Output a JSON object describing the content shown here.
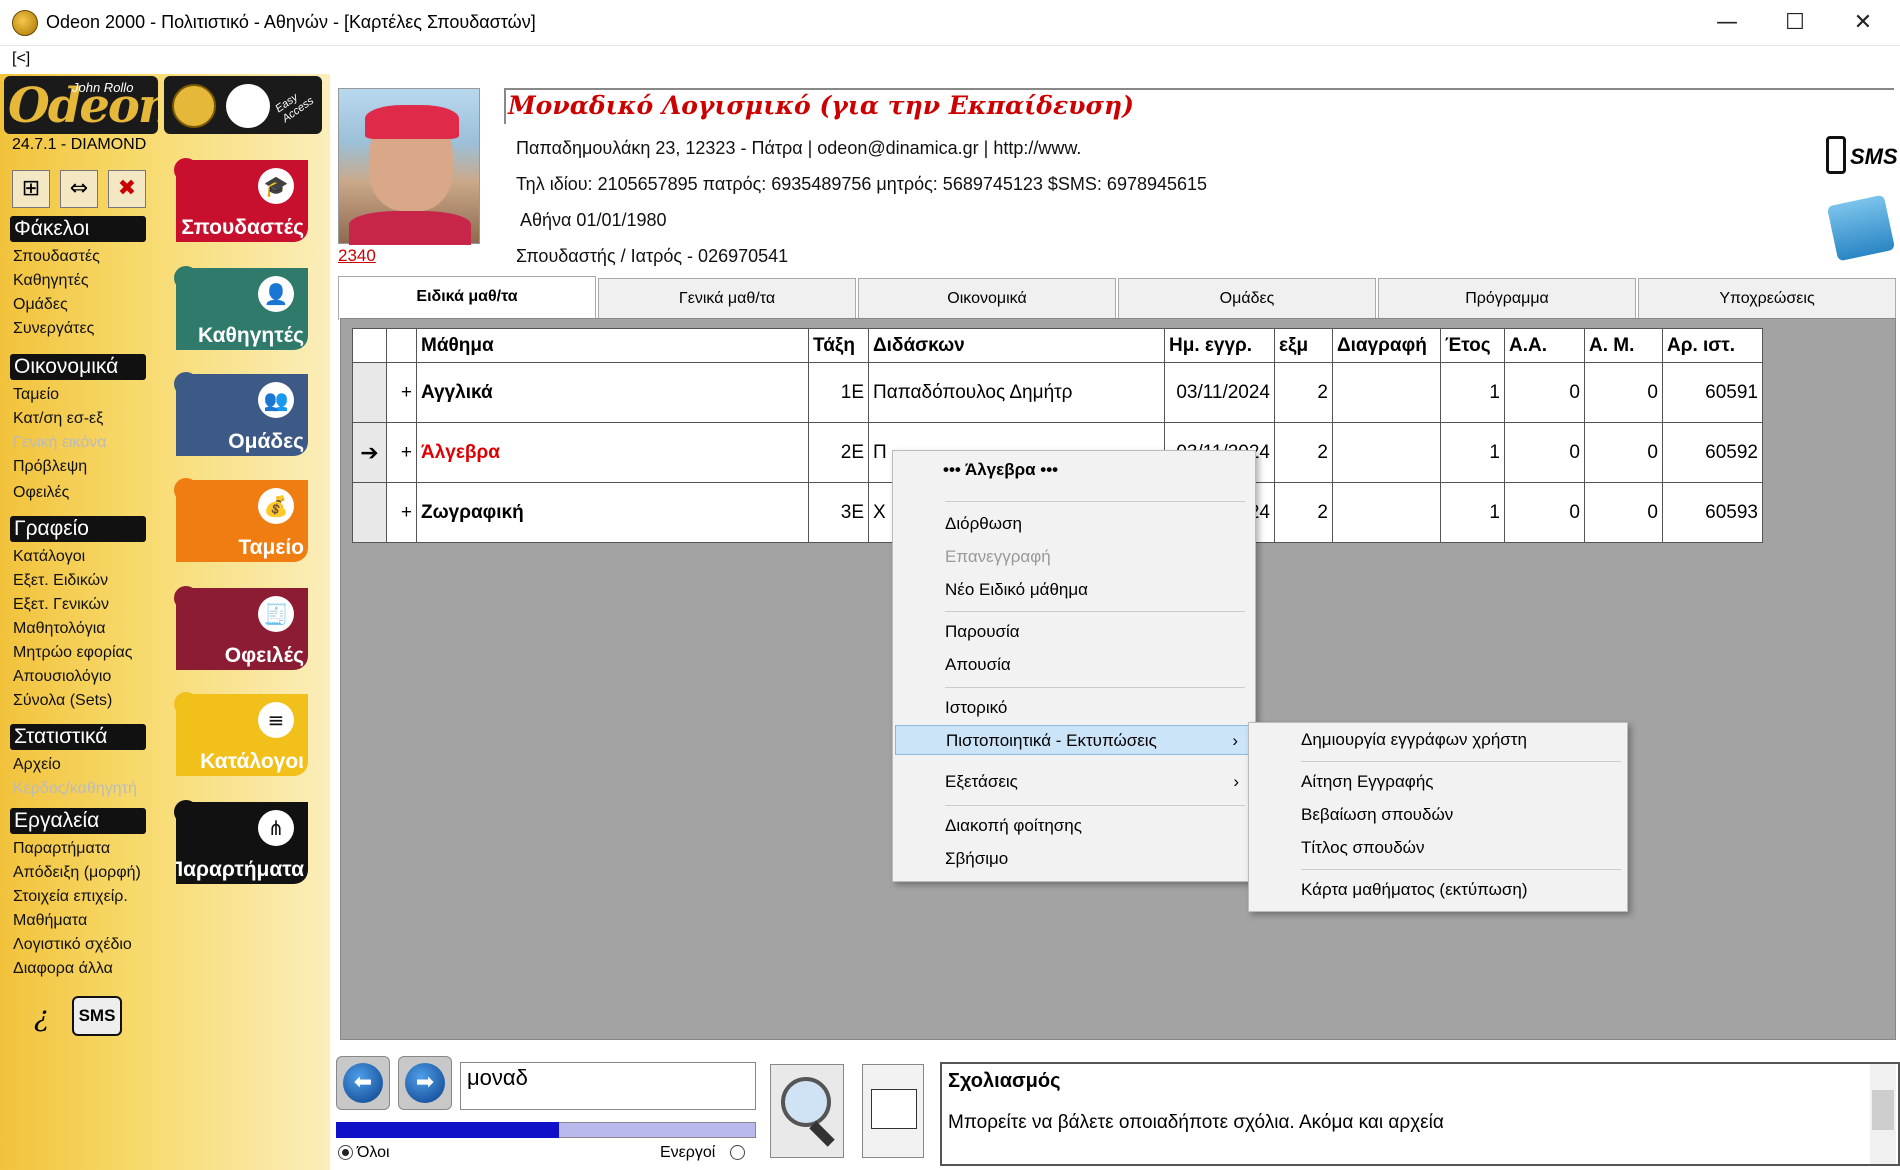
{
  "window": {
    "title": "Odeon 2000 - Πολιτιστικό - Αθηνών - [Καρτέλες Σπουδαστών]",
    "minimize": "—",
    "maximize": "☐",
    "close": "✕"
  },
  "menubar": {
    "back": "[<]"
  },
  "logo": {
    "brand": "Odeon",
    "author": "John Rollo",
    "version": "24.7.1 - DIAMOND",
    "sub1": "Odeon",
    "sub2": "Easy Access"
  },
  "tools": {
    "grid": "⊞",
    "swap": "⇔",
    "close": "✖"
  },
  "sections": {
    "folders": {
      "title": "Φάκελοι",
      "items": [
        "Σπουδαστές",
        "Καθηγητές",
        "Ομάδες",
        "Συνεργάτες"
      ]
    },
    "finance": {
      "title": "Οικονομικά",
      "items": [
        "Ταμείο",
        "Κατ/ση εσ-εξ",
        "Γενική εικόνα",
        "Πρόβλεψη",
        "Οφειλές"
      ]
    },
    "office": {
      "title": "Γραφείο",
      "items": [
        "Κατάλογοι",
        "Εξετ. Ειδικών",
        "Εξετ. Γενικών",
        "Μαθητολόγια",
        "Μητρώο εφορίας",
        "Απουσιολόγιο",
        "Σύνολα (Sets)"
      ]
    },
    "stats": {
      "title": "Στατιστικά",
      "items": [
        "Αρχείο",
        "Κέρδος/καθηγητή"
      ]
    },
    "tools": {
      "title": "Εργαλεία",
      "items": [
        "Παραρτήματα",
        "Απόδειξη (μορφή)",
        "Στοιχεία επιχείρ.",
        "Μαθήματα",
        "Λογιστικό σχέδιο",
        "Διαφορα άλλα"
      ]
    }
  },
  "bottom_left": {
    "info": "¿",
    "sms": "SMS"
  },
  "big_buttons": [
    {
      "label": "Σπουδαστές",
      "color": "#c8102e",
      "icon": "🎓"
    },
    {
      "label": "Καθηγητές",
      "color": "#2f7a6a",
      "icon": "👤"
    },
    {
      "label": "Ομάδες",
      "color": "#3d5a86",
      "icon": "👥"
    },
    {
      "label": "Ταμείο",
      "color": "#f07d12",
      "icon": "💰"
    },
    {
      "label": "Οφειλές",
      "color": "#8c1c33",
      "icon": "🧾"
    },
    {
      "label": "Κατάλογοι",
      "color": "#f2c01a",
      "icon": "≡"
    },
    {
      "label": "Παραρτήματα",
      "color": "#111111",
      "icon": "⋔"
    }
  ],
  "student": {
    "photo_id": "2340",
    "name": "Μοναδικό Λογισμικό (για την Εκπαίδευση)",
    "address": "Παπαδημουλάκη 23, 12323 - Πάτρα | odeon@dinamica.gr | http://www.",
    "phones": "Τηλ ιδίου: 2105657895 πατρός: 6935489756 μητρός: 5689745123 $SMS: 6978945615",
    "birth": "Αθήνα 01/01/1980",
    "role": "Σπουδαστής / Ιατρός - 026970541",
    "sms_label": "SMS"
  },
  "tabs": [
    "Ειδικά μαθ/τα",
    "Γενικά μαθ/τα",
    "Οικονομικά",
    "Ομάδες",
    "Πρόγραμμα",
    "Υποχρεώσεις"
  ],
  "table": {
    "headers": [
      "",
      "",
      "Μάθημα",
      "Τάξη",
      "Διδάσκων",
      "Ημ. εγγρ.",
      "εξμ",
      "Διαγραφή",
      "Έτος",
      "Α.Α.",
      "Α. Μ.",
      "Αρ. ιστ."
    ],
    "rows": [
      {
        "marker": "",
        "plus": "+",
        "subject": "Αγγλικά",
        "class": "1Ε",
        "teacher": "Παπαδόπουλος Δημήτρ",
        "date": "03/11/2024",
        "sem": "2",
        "deleted": "",
        "year": "1",
        "aa": "0",
        "am": "0",
        "hist": "60591"
      },
      {
        "marker": "➔",
        "plus": "+",
        "subject": "Άλγεβρα",
        "class": "2Ε",
        "teacher": "Π",
        "date": "03/11/2024",
        "sem": "2",
        "deleted": "",
        "year": "1",
        "aa": "0",
        "am": "0",
        "hist": "60592"
      },
      {
        "marker": "",
        "plus": "+",
        "subject": "Ζωγραφική",
        "class": "3Ε",
        "teacher": "Χ",
        "date": "24",
        "sem": "2",
        "deleted": "",
        "year": "1",
        "aa": "0",
        "am": "0",
        "hist": "60593"
      }
    ]
  },
  "context_menu": {
    "header": "••• Άλγεβρα •••",
    "items": [
      "Διόρθωση",
      "Επανεγγραφή",
      "Νέο Ειδικό μάθημα",
      "Παρουσία",
      "Απουσία",
      "Ιστορικό",
      "Πιστοποιητικά - Εκτυπώσεις",
      "Εξετάσεις",
      "Διακοπή φοίτησης",
      "Σβήσιμο"
    ],
    "arrow": "›"
  },
  "submenu": {
    "items": [
      "Δημιουργία εγγράφων χρήστη",
      "Αίτηση Εγγραφής",
      "Βεβαίωση σπουδών",
      "Τίτλος σπουδών",
      "Κάρτα μαθήματος (εκτύπωση)"
    ]
  },
  "bottom": {
    "prev": "⬅",
    "next": "➡",
    "search_value": "μοναδ",
    "progress": 0.53,
    "radio_all": "Όλοι",
    "radio_active": "Ενεργοί",
    "comment_title": "Σχολιασμός",
    "comment_text": "Μπορείτε να βάλετε οποιαδήποτε σχόλια.  Ακόμα και αρχεία"
  }
}
